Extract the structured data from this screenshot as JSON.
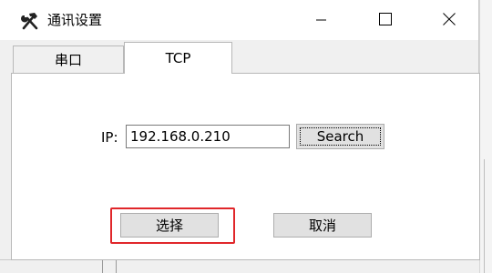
{
  "window": {
    "title": "通讯设置",
    "icon": "tools-icon",
    "controls": {
      "minimize_icon": "minimize-icon",
      "maximize_icon": "maximize-icon",
      "close_icon": "close-icon"
    }
  },
  "tabs": [
    {
      "label": "串口",
      "active": false
    },
    {
      "label": "TCP",
      "active": true
    }
  ],
  "tcp": {
    "ip_label": "IP:",
    "ip_value": "192.168.0.210",
    "search_label": "Search"
  },
  "actions": {
    "select_label": "选择",
    "cancel_label": "取消"
  },
  "colors": {
    "highlight": "#e0262a",
    "button_face": "#e1e1e1",
    "panel": "#ffffff",
    "chrome": "#f0f0f0"
  }
}
